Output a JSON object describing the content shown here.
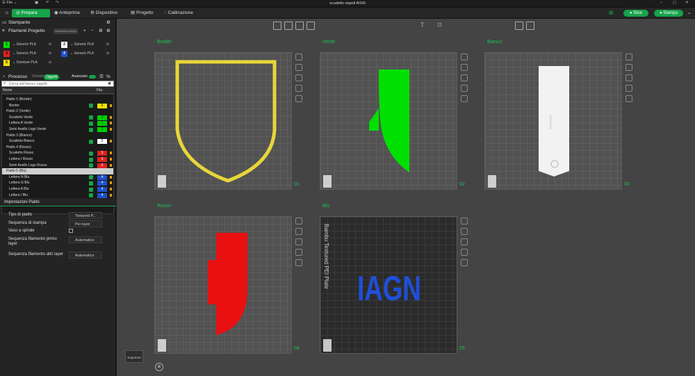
{
  "window": {
    "title": "scudetto napoli AIGN",
    "menu_file": "File"
  },
  "nav": {
    "prepara": "Prepara",
    "anteprima": "Anteprima",
    "dispositivo": "Dispositivo",
    "progetto": "Progetto",
    "calibrazione": "Calibrazione",
    "slice": "Slice",
    "stampa": "Stampa"
  },
  "left": {
    "stampante": "Stampante",
    "filamenti": "Filamenti Progetto",
    "filamenti_btn": "Seleziona spurgo",
    "filaments": [
      {
        "num": "1",
        "name": "Generic PLA",
        "color": "#00e000"
      },
      {
        "num": "2",
        "name": "Generic PLA",
        "color": "#ffffff"
      },
      {
        "num": "3",
        "name": "Generic PLA",
        "color": "#e02020"
      },
      {
        "num": "4",
        "name": "Generic PLA",
        "color": "#2050d0"
      },
      {
        "num": "5",
        "name": "Overture PLA",
        "color": "#f0e000"
      }
    ],
    "processo": "Processo",
    "globale": "Globale",
    "oggetti": "Oggetti",
    "avanzato": "Avanzato",
    "search_placeholder": "Cerca nell'elenco oggetti",
    "col_nome": "Nome",
    "col_fila": "Fila.",
    "tree": [
      {
        "label": "Piatto 1 (Border)",
        "indent": 1,
        "fila": "",
        "color": ""
      },
      {
        "label": "Border",
        "indent": 2,
        "fila": "5",
        "color": "#f0e000"
      },
      {
        "label": "Piatto 2 (Verde)",
        "indent": 1,
        "fila": "",
        "color": ""
      },
      {
        "label": "Scudetto Verde",
        "indent": 2,
        "fila": "1",
        "color": "#00d000"
      },
      {
        "label": "Lettera A Verde",
        "indent": 2,
        "fila": "1",
        "color": "#00d000"
      },
      {
        "label": "Semi Anello Logo Verde",
        "indent": 2,
        "fila": "1",
        "color": "#00d000"
      },
      {
        "label": "Piatto 3 (Bianco)",
        "indent": 1,
        "fila": "",
        "color": ""
      },
      {
        "label": "Scudetto Bianco",
        "indent": 2,
        "fila": "2",
        "color": "#ffffff"
      },
      {
        "label": "Piatto 4 (Rosso)",
        "indent": 1,
        "fila": "",
        "color": ""
      },
      {
        "label": "Scudetto Rosso",
        "indent": 2,
        "fila": "3",
        "color": "#e02020"
      },
      {
        "label": "Lettera I Rosso",
        "indent": 2,
        "fila": "3",
        "color": "#e02020"
      },
      {
        "label": "Semi Anello Logo Rosso",
        "indent": 2,
        "fila": "3",
        "color": "#e02020"
      },
      {
        "label": "Piatto 5 (Blu)",
        "indent": 1,
        "fila": "",
        "color": "",
        "selected": true
      },
      {
        "label": "Lettera N Blu",
        "indent": 2,
        "fila": "4",
        "color": "#2050d0"
      },
      {
        "label": "Lettera G Blu",
        "indent": 2,
        "fila": "4",
        "color": "#2050d0"
      },
      {
        "label": "Lettera A Blu",
        "indent": 2,
        "fila": "4",
        "color": "#2050d0"
      },
      {
        "label": "Lettera I Blu",
        "indent": 2,
        "fila": "4",
        "color": "#2050d0"
      }
    ],
    "impostazioni": "Impostazioni Piatto",
    "settings": [
      {
        "label": "Tipo di piatto",
        "value": "Textured P..."
      },
      {
        "label": "Sequenza di stampa",
        "value": "Per layer"
      },
      {
        "label": "Vaso a spirale",
        "value": ""
      },
      {
        "label": "Sequenza filamento primo layer",
        "value": "Automatico"
      },
      {
        "label": "Sequenza filamento altri layer",
        "value": "Automatico"
      }
    ]
  },
  "plates": [
    {
      "label": "Border",
      "num": "01"
    },
    {
      "label": "Verde",
      "num": "02"
    },
    {
      "label": "Bianco",
      "num": "03"
    },
    {
      "label": "Rosso",
      "num": "04"
    },
    {
      "label": "Blu",
      "num": "05"
    }
  ],
  "plate5": {
    "bed_text": "Bambu Textured PEI Plate",
    "model_text": "IAGN"
  },
  "view": {
    "superiore": "Superiore"
  },
  "colors": {
    "accent": "#17a34a",
    "yellow": "#e8d63a",
    "green": "#00e000",
    "white": "#f2f2f2",
    "red": "#e81010",
    "blue": "#1f4fd8"
  }
}
